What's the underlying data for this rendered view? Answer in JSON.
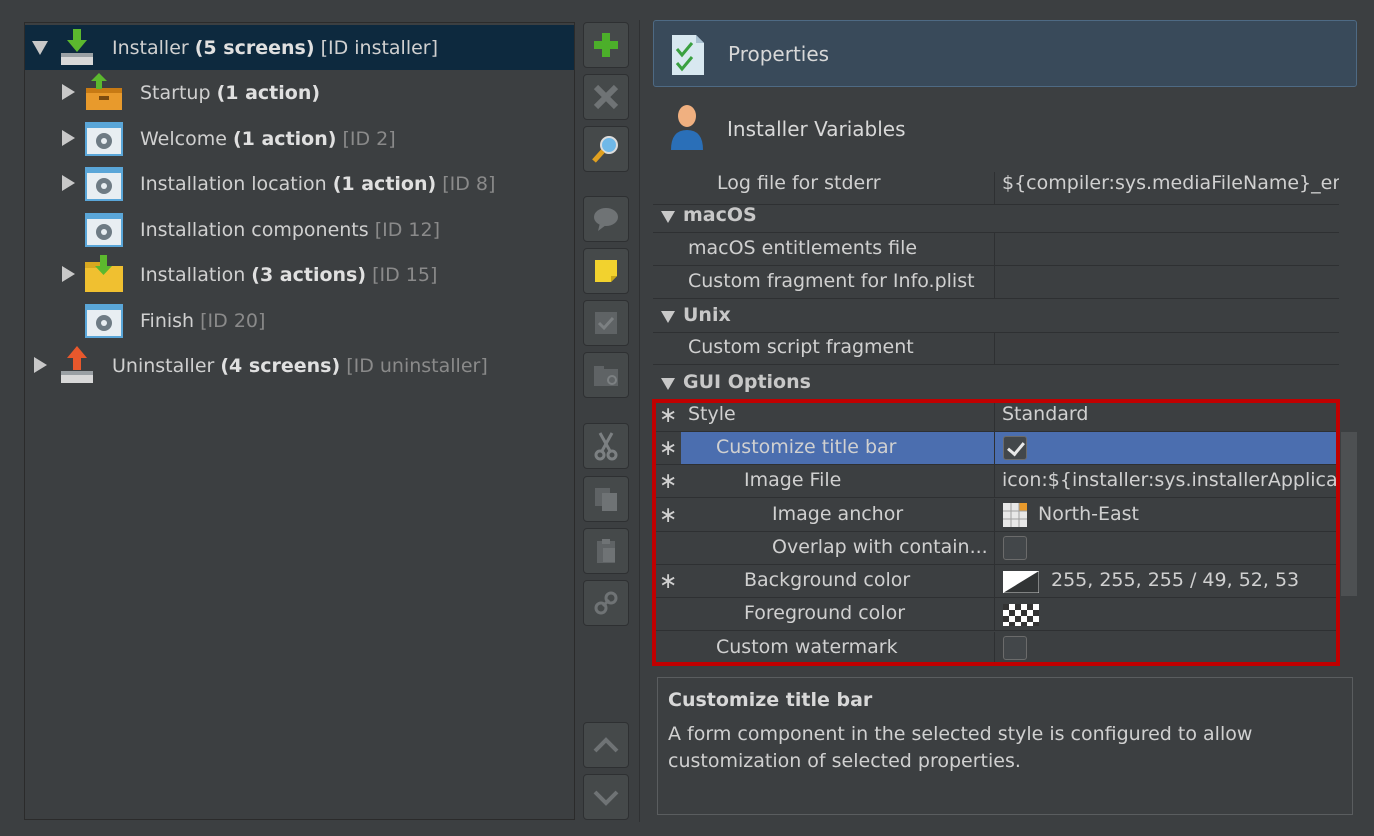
{
  "tree": {
    "items": [
      {
        "name": "Installer",
        "count": "(5 screens)",
        "id": "[ID installer]"
      },
      {
        "name": "Startup",
        "count": "(1 action)",
        "id": ""
      },
      {
        "name": "Welcome",
        "count": "(1 action)",
        "id": "[ID 2]"
      },
      {
        "name": "Installation location",
        "count": "(1 action)",
        "id": "[ID 8]"
      },
      {
        "name": "Installation components",
        "count": "",
        "id": "[ID 12]"
      },
      {
        "name": "Installation",
        "count": "(3 actions)",
        "id": "[ID 15]"
      },
      {
        "name": "Finish",
        "count": "",
        "id": "[ID 20]"
      },
      {
        "name": "Uninstaller",
        "count": "(4 screens)",
        "id": "[ID uninstaller]"
      }
    ]
  },
  "toolbar": {
    "icons": [
      "add-icon",
      "delete-icon",
      "search-icon",
      "comment-icon",
      "note-icon",
      "check-icon",
      "folder-icon",
      "cut-icon",
      "copy-icon",
      "paste-icon",
      "link-icon",
      "move-up-icon",
      "move-down-icon"
    ]
  },
  "right": {
    "properties_label": "Properties",
    "variables_label": "Installer Variables"
  },
  "grid": {
    "log_stderr_name": "Log file for stderr",
    "log_stderr_value": "${compiler:sys.mediaFileName}_err...",
    "cat_macos": "macOS",
    "macos_entitlements": "macOS entitlements file",
    "info_plist": "Custom fragment for Info.plist",
    "cat_unix": "Unix",
    "custom_script": "Custom script fragment",
    "cat_gui": "GUI Options",
    "style_name": "Style",
    "style_value": "Standard",
    "customize_title_bar": "Customize title bar",
    "image_file_name": "Image File",
    "image_file_value": "icon:${installer:sys.installerApplica...",
    "image_anchor_name": "Image anchor",
    "image_anchor_value": "North-East",
    "overlap_name": "Overlap with contain...",
    "bg_color_name": "Background color",
    "bg_color_value": "255, 255, 255 / 49, 52, 53",
    "fg_color_name": "Foreground color",
    "custom_watermark": "Custom watermark",
    "star": "∗"
  },
  "description": {
    "title": "Customize title bar",
    "text": "A form component in the selected style is configured to allow customization of selected properties."
  },
  "colors": {
    "accent": "#4b6eaf",
    "highlight_border": "#c00000",
    "selected_tree": "#0d293e"
  }
}
